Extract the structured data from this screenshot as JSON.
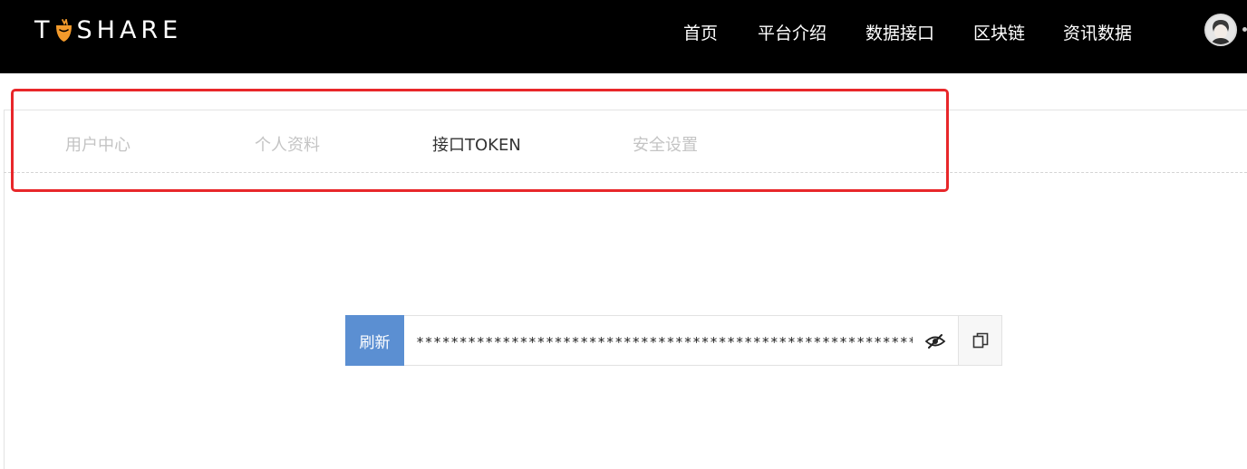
{
  "header": {
    "logo_first": "T",
    "logo_rest": "SHARE",
    "nav": [
      {
        "label": "首页"
      },
      {
        "label": "平台介绍"
      },
      {
        "label": "数据接口"
      },
      {
        "label": "区块链"
      },
      {
        "label": "资讯数据"
      }
    ]
  },
  "tabs": [
    {
      "label": "用户中心",
      "active": false
    },
    {
      "label": "个人资料",
      "active": false
    },
    {
      "label": "接口TOKEN",
      "active": true
    },
    {
      "label": "安全设置",
      "active": false
    }
  ],
  "token": {
    "refresh_label": "刷新",
    "masked_value": "*******************************************************************"
  },
  "colors": {
    "header_bg": "#000000",
    "refresh_bg": "#5b8fd2",
    "highlight": "#e8272a",
    "carrot": "#f39a2b"
  }
}
